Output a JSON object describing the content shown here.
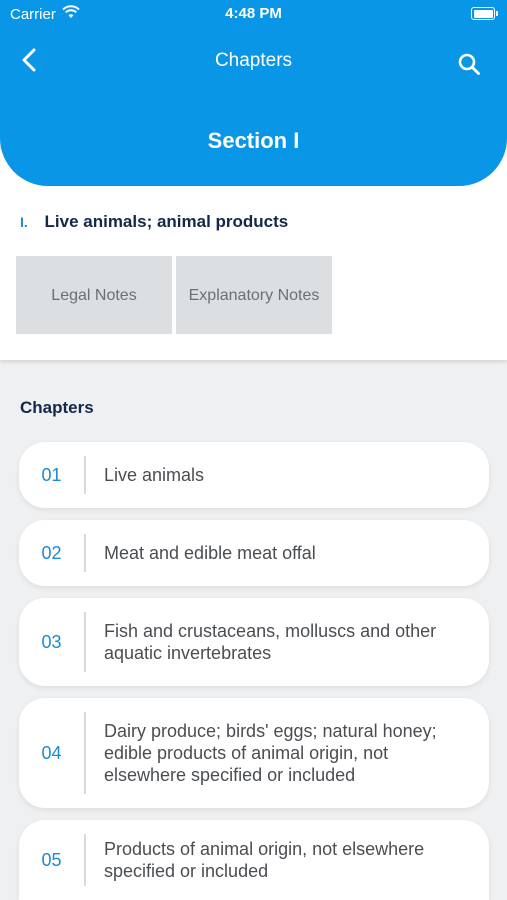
{
  "status": {
    "carrier": "Carrier",
    "time": "4:48 PM"
  },
  "nav": {
    "title": "Chapters",
    "section": "Section I"
  },
  "section": {
    "number": "I.",
    "name": "Live animals; animal products"
  },
  "buttons": {
    "legal": "Legal Notes",
    "explanatory": "Explanatory Notes"
  },
  "chapters_heading": "Chapters",
  "chapters": [
    {
      "code": "01",
      "title": "Live animals"
    },
    {
      "code": "02",
      "title": "Meat and edible meat offal"
    },
    {
      "code": "03",
      "title": "Fish and crustaceans, molluscs and other aquatic invertebrates"
    },
    {
      "code": "04",
      "title": "Dairy produce; birds' eggs; natural honey; edible products of animal origin, not elsewhere specified or included"
    },
    {
      "code": "05",
      "title": "Products of animal origin, not elsewhere specified or included"
    }
  ],
  "colors": {
    "accent": "#0a96e6",
    "code": "#1b8bd4",
    "heading": "#14284b"
  }
}
